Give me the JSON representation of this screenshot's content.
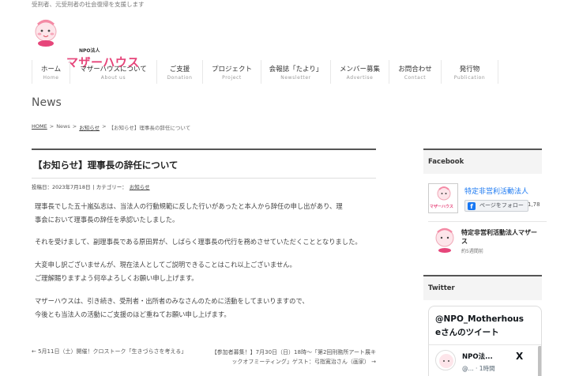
{
  "site": {
    "tagline": "受刑者、元受刑者の社会復帰を支援します",
    "logo_small": "NPO法人",
    "logo_main": "マザーハウス"
  },
  "nav": [
    {
      "jp": "ホーム",
      "en": "Home"
    },
    {
      "jp": "マザーハウスについて",
      "en": "About us"
    },
    {
      "jp": "ご支援",
      "en": "Donation"
    },
    {
      "jp": "プロジェクト",
      "en": "Project"
    },
    {
      "jp": "会報誌「たより」",
      "en": "Newsletter"
    },
    {
      "jp": "メンバー募集",
      "en": "Advertise"
    },
    {
      "jp": "お問合わせ",
      "en": "Contact"
    },
    {
      "jp": "発行物",
      "en": "Publication"
    }
  ],
  "page_heading": "News",
  "breadcrumb": {
    "home": "HOME",
    "sep": ">",
    "news": "News",
    "category": "お知らせ",
    "current": "【お知らせ】理事長の辞任について"
  },
  "article": {
    "title": "【お知らせ】理事長の辞任について",
    "date_label": "投稿日：2023年7月18日",
    "category_label": "| カテゴリー：",
    "category": "お知らせ",
    "paragraphs": [
      [
        "理事長でした五十嵐弘志は、当法人の行動規範に反した行いがあったと本人から辞任の申し出があり、理",
        "事会において理事長の辞任を承認いたしました。"
      ],
      [
        "それを受けまして、副理事長である原田昇が、しばらく理事長の代行を務めさせていただくこととなりました。"
      ],
      [
        "大変申し訳ございませんが、現在法人としてご説明できることはこれ以上ございません。",
        "ご理解賜りますよう何卒よろしくお願い申し上げます。"
      ],
      [
        "マザーハウスは、引き続き、受刑者・出所者のみなさんのために活動をしてまいりますので、",
        "今後とも当法人の活動にご支援のほど重ねてお願い申し上げます。"
      ]
    ]
  },
  "post_nav": {
    "prev": "← 5月11日（土）開催！クロストーク「生きづらさを考える」",
    "next_line1": "【参加者募集！】7月30日（日）18時〜「第2回刑務所アート展キ",
    "next_line2": "ックオフミーティング」ゲスト：弓指寛治さん（画家） →"
  },
  "sidebar": {
    "facebook_heading": "Facebook",
    "fb_page_name": "特定非営利活動法人",
    "fb_avatar_text": "マザーハウス",
    "fb_follow": "ページをフォロー",
    "fb_follow_icon": "f",
    "fb_count": "1,78",
    "fb_name2": "特定非営利活動法人マザー",
    "fb_name2b": "ス",
    "fb_sub2": "約5週間前",
    "twitter_heading": "Twitter",
    "tw_title_1": "@NPO_Motherhous",
    "tw_title_2": "eさんのツイート",
    "tw_name": "NPO法...",
    "tw_handle": "@... · 1時間",
    "tw_x": "X"
  }
}
